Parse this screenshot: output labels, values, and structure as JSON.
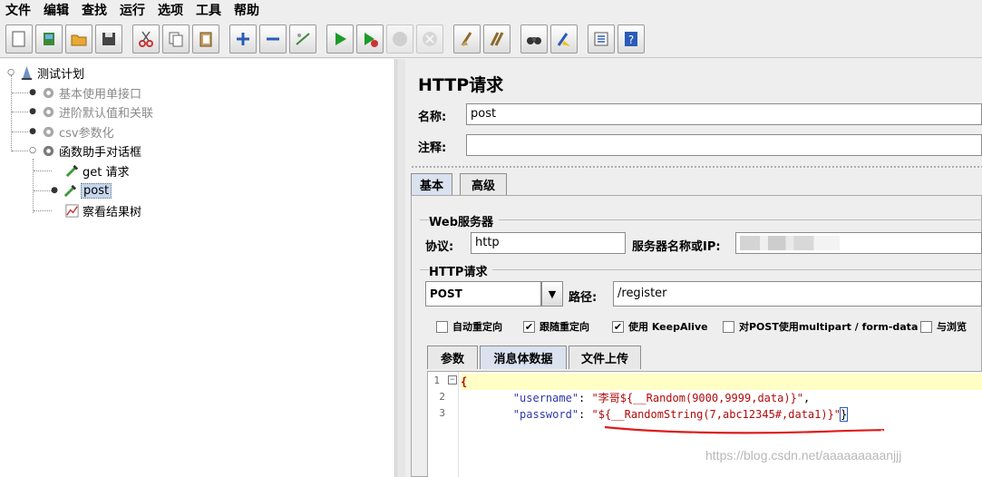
{
  "menu": [
    "文件",
    "编辑",
    "查找",
    "运行",
    "选项",
    "工具",
    "帮助"
  ],
  "toolbar": {
    "icons": [
      "new-icon",
      "templates-icon",
      "open-icon",
      "save-icon",
      "cut-icon",
      "copy-icon",
      "paste-icon",
      "expand-icon",
      "collapse-icon",
      "toggle-icon",
      "start-icon",
      "start-no-pause-icon",
      "stop-icon",
      "shutdown-icon",
      "clear-icon",
      "clear-all-icon",
      "search-icon",
      "reset-search-icon",
      "function-helper-icon",
      "help-icon"
    ]
  },
  "tree": {
    "root": "测试计划",
    "items": [
      {
        "label": "基本使用单接口",
        "dim": true
      },
      {
        "label": "进阶默认值和关联",
        "dim": true
      },
      {
        "label": "csv参数化",
        "dim": true
      },
      {
        "label": "函数助手对话框",
        "dim": false
      },
      {
        "label": "get 请求",
        "dim": false
      },
      {
        "label": "post",
        "dim": false,
        "selected": true
      },
      {
        "label": "察看结果树",
        "dim": false
      }
    ]
  },
  "panel": {
    "title": "HTTP请求",
    "name_label": "名称:",
    "name_value": "post",
    "comment_label": "注释:",
    "comment_value": "",
    "tabs": [
      "基本",
      "高级"
    ],
    "web_server_group": "Web服务器",
    "protocol_label": "协议:",
    "protocol_value": "http",
    "server_label": "服务器名称或IP:",
    "http_request_group": "HTTP请求",
    "method_value": "POST",
    "path_label": "路径:",
    "path_value": "/register",
    "checkboxes": [
      {
        "label": "自动重定向",
        "checked": false
      },
      {
        "label": "跟随重定向",
        "checked": true
      },
      {
        "label": "使用 KeepAlive",
        "checked": true
      },
      {
        "label": "对POST使用multipart / form-data",
        "checked": false
      },
      {
        "label": "与浏览",
        "checked": false
      }
    ],
    "sub_tabs": [
      "参数",
      "消息体数据",
      "文件上传"
    ],
    "body_lines": [
      {
        "n": "1",
        "text": "{"
      },
      {
        "n": "2",
        "key": "\"username\"",
        "sep": ": ",
        "val": "\"李哥${__Random(9000,9999,data)}\"",
        "tail": ","
      },
      {
        "n": "3",
        "key": "\"password\"",
        "sep": ": ",
        "val": "\"${__RandomString(7,abc12345#,data1)}\"",
        "tail": "}"
      }
    ]
  },
  "watermark": "https://blog.csdn.net/aaaaaaaaanjjj"
}
